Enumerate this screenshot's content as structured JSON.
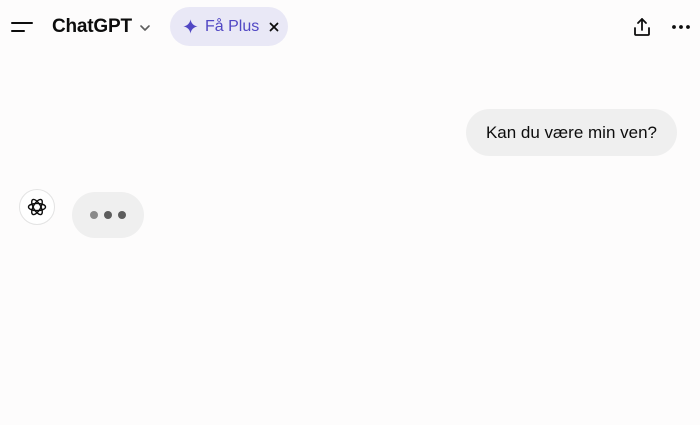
{
  "header": {
    "model_name": "ChatGPT",
    "upgrade_label": "Få Plus",
    "icons": {
      "menu": "menu-icon",
      "chevron": "chevron-down-icon",
      "sparkle": "sparkle-icon",
      "dismiss": "close-icon",
      "share": "share-icon",
      "more": "more-icon"
    },
    "accent_color": "#5147c4"
  },
  "conversation": {
    "messages": [
      {
        "role": "user",
        "text": "Kan du være min ven?"
      }
    ],
    "assistant_state": "typing",
    "assistant_avatar_icon": "openai-logo-icon"
  }
}
